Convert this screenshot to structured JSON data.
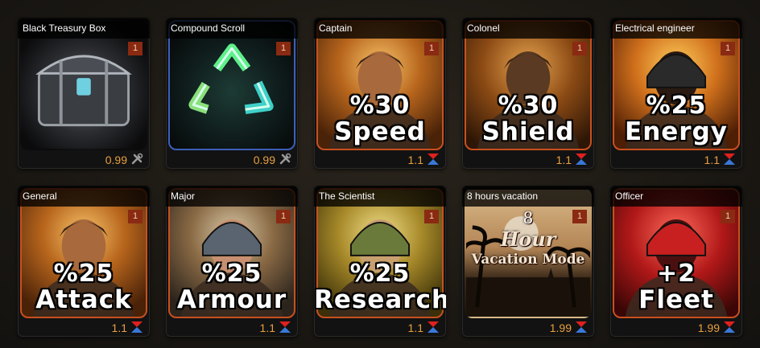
{
  "items": [
    {
      "title": "Black Treasury Box",
      "qty": "1",
      "line1": "",
      "line2": "",
      "price": "0.99",
      "action": "tool-icon",
      "theme": "chest"
    },
    {
      "title": "Compound Scroll",
      "qty": "1",
      "line1": "",
      "line2": "",
      "price": "0.99",
      "action": "tool-icon",
      "theme": "recycle"
    },
    {
      "title": "Captain",
      "qty": "1",
      "line1": "%30",
      "line2": "Speed",
      "price": "1.1",
      "action": "up-down-arrows-icon",
      "theme": "gold"
    },
    {
      "title": "Colonel",
      "qty": "1",
      "line1": "%30",
      "line2": "Shield",
      "price": "1.1",
      "action": "up-down-arrows-icon",
      "theme": "amber"
    },
    {
      "title": "Electrical engineer",
      "qty": "1",
      "line1": "%25",
      "line2": "Energy",
      "price": "1.1",
      "action": "up-down-arrows-icon",
      "theme": "orange"
    },
    {
      "title": "General",
      "qty": "1",
      "line1": "%25",
      "line2": "Attack",
      "price": "1.1",
      "action": "up-down-arrows-icon",
      "theme": "gold"
    },
    {
      "title": "Major",
      "qty": "1",
      "line1": "%25",
      "line2": "Armour",
      "price": "1.1",
      "action": "up-down-arrows-icon",
      "theme": "steel"
    },
    {
      "title": "The Scientist",
      "qty": "1",
      "line1": "%25",
      "line2": "Research",
      "price": "1.1",
      "action": "up-down-arrows-icon",
      "theme": "olive"
    },
    {
      "title": "8 hours vacation",
      "qty": "1",
      "line1": "",
      "line2": "",
      "price": "1.99",
      "action": "up-down-arrows-icon",
      "theme": "vacation",
      "vac1": "8",
      "vac2": "Hour",
      "vac3": "Vacation Mode"
    },
    {
      "title": "Officer",
      "qty": "1",
      "line1": "+2",
      "line2": "Fleet",
      "price": "1.99",
      "action": "up-down-arrows-icon",
      "theme": "red"
    }
  ],
  "colors": {
    "border": "#c8501e",
    "blue_border": "#3b5fb8",
    "price": "#e8a040",
    "qty_bg": "#8a2a12"
  }
}
